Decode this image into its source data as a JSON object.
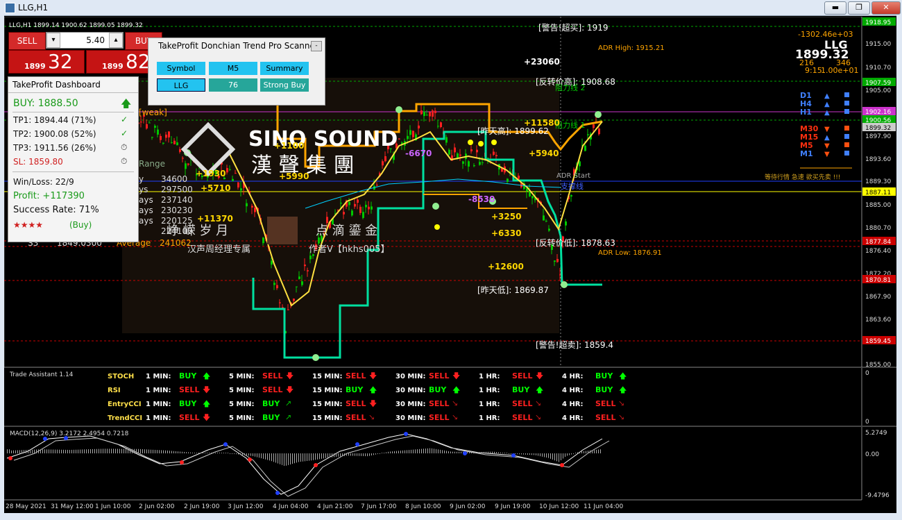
{
  "window": {
    "title": "LLG,H1",
    "minimize": "▬",
    "maximize": "❐",
    "close": "✕"
  },
  "ohlc_line": "LLG,H1  1899.14 1900.62 1899.05 1899.32",
  "trade": {
    "sell_label": "SELL",
    "buy_label": "BUY",
    "lot": "5.40",
    "minus": "▾",
    "plus": "▴",
    "sell_small": "1899",
    "sell_big": "32",
    "buy_small": "1899",
    "buy_big": "82"
  },
  "scanner": {
    "title": "TakeProfit Donchian Trend Pro Scanner",
    "minimize": "-",
    "row1": [
      "Symbol",
      "M5",
      "Summary"
    ],
    "row2": [
      "LLG",
      "76",
      "Strong Buy"
    ]
  },
  "dashboard": {
    "title": "TakeProfit Dashboard",
    "signal": "BUY: 1888.50",
    "signal_arrow": "🡅",
    "tp1": "TP1: 1894.44 (71%)",
    "tp2": "TP2: 1900.08 (52%)",
    "tp3": "TP3: 1911.56 (26%)",
    "sl": "SL:  1859.80",
    "check": "✓",
    "pending": "⏱",
    "winloss": "Win/Loss: 22/9",
    "profit": "Profit: +117390",
    "success": "Success Rate: 71%",
    "stars": "★★★★",
    "stars_label": "(Buy)"
  },
  "top_right": {
    "symbol": "LLG",
    "price": "1899.32",
    "v1": "-1302.46e+03",
    "v2": "216",
    "v3": "346",
    "v4": "9:15",
    "v5": "1.00e+01",
    "tf_labels": [
      "D1",
      "H4",
      "H1",
      "M30",
      "M15",
      "M5",
      "M1"
    ]
  },
  "chart_labels": {
    "warn_high": "[警告!超买]: 1919",
    "warn_low": "[警告!超卖]: 1859.4",
    "reverse_high": "[反转价高]: 1908.68",
    "reverse_low": "[反转价低]: 1878.63",
    "yest_high": "[昨天高]: 1899.62",
    "yest_low": "[昨天低]: 1869.87",
    "adr_high": "ADR High: 1915.21",
    "adr_low": "ADR Low: 1876.91",
    "adr_start": "ADR Start",
    "resist2": "阻力线 2",
    "resist1": "阻力线 1",
    "support": "支撑线",
    "tip": "等待行情 急速 欲买先卖 !!!",
    "weak": "[weak]",
    "range": "Range",
    "profits": [
      "+23060",
      "+11580",
      "+5940",
      "+1930",
      "+5710",
      "+5990",
      "+11370",
      "+3250",
      "+6330",
      "+12600",
      "+1100"
    ],
    "losses": [
      "-6670",
      "-8530"
    ],
    "wm_title": "SINO SOUND",
    "wm_sub": "漢 聲 集 團",
    "wm_line2": "峥  嵘  岁  月",
    "wm_line3": "点  滴  鎏  金",
    "wm_line4": "汉声周经理专属",
    "wm_line5": "作者V【hkhs005】",
    "pivots": [
      "y",
      "ys",
      "ays",
      "ays",
      "ays"
    ],
    "pivot_vals": [
      "34600",
      "297500",
      "237140",
      "230230",
      "220125",
      "224100"
    ],
    "s3": "S3",
    "s3_val": "1849.0300",
    "average": "Average",
    "avg_val": "241062"
  },
  "price_axis": [
    "1918.95",
    "1915.00",
    "1910.70",
    "1907.59",
    "1905.00",
    "1902.16",
    "1900.56",
    "1899.32",
    "1897.90",
    "1893.60",
    "1889.30",
    "1887.11",
    "1885.00",
    "1880.70",
    "1877.84",
    "1876.40",
    "1872.20",
    "1870.81",
    "1867.90",
    "1863.60",
    "1859.45",
    "1855.00"
  ],
  "price_axis_highlight": {
    "1918.95": "#00aa00",
    "1907.59": "#00aa00",
    "1902.16": "#cc33cc",
    "1900.56": "#00aa00",
    "1899.32": "#cccccc",
    "1887.11": "#ffff00",
    "1877.84": "#cc0000",
    "1870.81": "#cc0000",
    "1859.45": "#cc0000"
  },
  "assistant": {
    "title": "Trade Assistant 1.14",
    "axis_top": "0",
    "axis_bottom": "0",
    "rows": [
      {
        "name": "STOCH",
        "cells": [
          [
            "1 MIN:",
            "BUY",
            "up"
          ],
          [
            "5 MIN:",
            "SELL",
            "down"
          ],
          [
            "15 MIN:",
            "SELL",
            "down"
          ],
          [
            "30 MIN:",
            "SELL",
            "down"
          ],
          [
            "1 HR:",
            "SELL",
            "down"
          ],
          [
            "4 HR:",
            "BUY",
            "up"
          ]
        ]
      },
      {
        "name": "RSI",
        "cells": [
          [
            "1 MIN:",
            "SELL",
            "down"
          ],
          [
            "5 MIN:",
            "SELL",
            "down"
          ],
          [
            "15 MIN:",
            "BUY",
            "up"
          ],
          [
            "30 MIN:",
            "BUY",
            "up"
          ],
          [
            "1 HR:",
            "BUY",
            "up"
          ],
          [
            "4 HR:",
            "BUY",
            "up"
          ]
        ]
      },
      {
        "name": "EntryCCI",
        "cells": [
          [
            "1 MIN:",
            "BUY",
            "up"
          ],
          [
            "5 MIN:",
            "BUY",
            "upright"
          ],
          [
            "15 MIN:",
            "SELL",
            "down"
          ],
          [
            "30 MIN:",
            "SELL",
            "downright"
          ],
          [
            "1 HR:",
            "SELL",
            "downright"
          ],
          [
            "4 HR:",
            "SELL",
            "downright"
          ]
        ]
      },
      {
        "name": "TrendCCI",
        "cells": [
          [
            "1 MIN:",
            "SELL",
            "down"
          ],
          [
            "5 MIN:",
            "BUY",
            "upright"
          ],
          [
            "15 MIN:",
            "SELL",
            "downright"
          ],
          [
            "30 MIN:",
            "SELL",
            "downright"
          ],
          [
            "1 HR:",
            "SELL",
            "downright"
          ],
          [
            "4 HR:",
            "SELL",
            "downright"
          ]
        ]
      }
    ]
  },
  "macd": {
    "label": "MACD(12,26,9) 3.2172 2.4954 0.7218",
    "axis": [
      "5.2749",
      "0.00",
      "-9.4796"
    ]
  },
  "time_axis": [
    "28 May 2021",
    "31 May 12:00",
    "1 Jun 10:00",
    "2 Jun 02:00",
    "2 Jun 19:00",
    "3 Jun 12:00",
    "4 Jun 04:00",
    "4 Jun 21:00",
    "7 Jun 17:00",
    "8 Jun 10:00",
    "9 Jun 02:00",
    "9 Jun 19:00",
    "10 Jun 12:00",
    "11 Jun 04:00"
  ],
  "colors": {
    "buy": "#00ff00",
    "sell": "#ff2020",
    "gold": "#ffb000",
    "aqua": "#00e0a0",
    "yellow": "#ffff40"
  }
}
